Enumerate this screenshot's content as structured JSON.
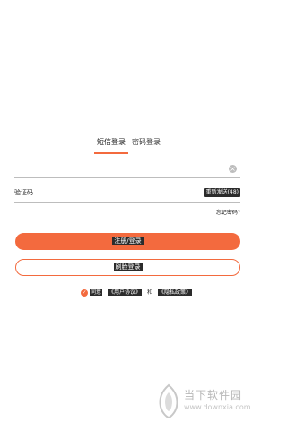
{
  "tabs": {
    "sms_login": "短信登录",
    "password_login": "密码登录"
  },
  "phone_field": {
    "value": "",
    "placeholder": ""
  },
  "code_field": {
    "label": "验证码",
    "resend_label": "重新发送(48)"
  },
  "forgot_password": "忘记密码?",
  "buttons": {
    "register_login": "注册/登录",
    "quick_login": "刷脸登录"
  },
  "agreement": {
    "agree": "同意",
    "user_agreement": "《用户协议》",
    "and": "和",
    "privacy_policy": "《隐私政策》"
  },
  "watermark": {
    "title": "当下软件园",
    "url": "www.downxia.com"
  },
  "colors": {
    "accent": "#f36a3e",
    "divider": "#bdbdbd"
  }
}
